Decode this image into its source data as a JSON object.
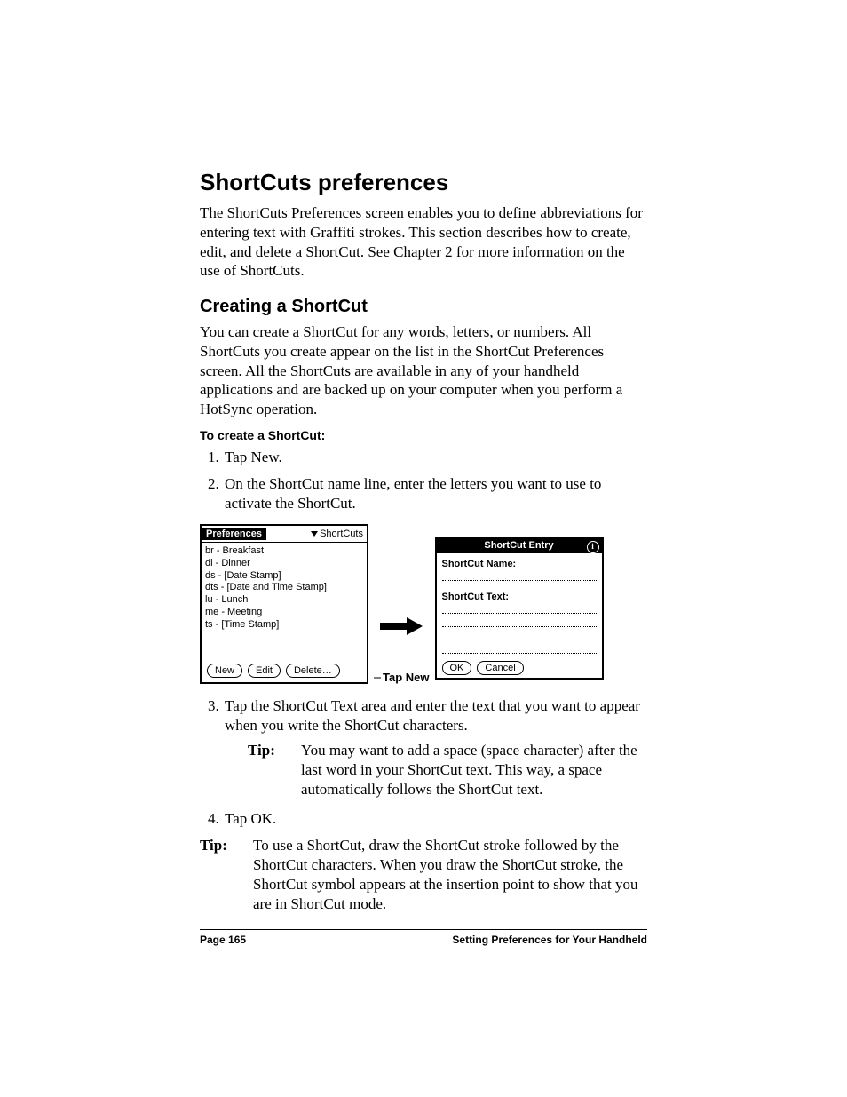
{
  "heading": "ShortCuts preferences",
  "intro": "The ShortCuts Preferences screen enables you to define abbreviations for entering text with Graffiti strokes. This section describes how to create, edit, and delete a ShortCut. See Chapter 2 for more information on the use of ShortCuts.",
  "sub_heading": "Creating a ShortCut",
  "sub_intro": "You can create a ShortCut for any words, letters, or numbers. All ShortCuts you create appear on the list in the ShortCut Preferences screen. All the ShortCuts are available in any of your handheld applications and are backed up on your computer when you perform a HotSync operation.",
  "procedure_title": "To create a ShortCut:",
  "steps": {
    "s1": "Tap New.",
    "s2": "On the ShortCut name line, enter the letters you want to use to activate the ShortCut.",
    "s3": "Tap the ShortCut Text area and enter the text that you want to appear when you write the ShortCut characters.",
    "tip3_label": "Tip:",
    "tip3_text": "You may want to add a space (space character) after the last word in your ShortCut text. This way, a space automatically follows the ShortCut text.",
    "s4": "Tap OK."
  },
  "final_tip_label": "Tip:",
  "final_tip_text": "To use a ShortCut, draw the ShortCut stroke followed by the ShortCut characters. When you draw the ShortCut stroke, the ShortCut symbol appears at the insertion point to show that you are in ShortCut mode.",
  "figure": {
    "left": {
      "title": "Preferences",
      "dropdown": "ShortCuts",
      "list": [
        "br - Breakfast",
        "di - Dinner",
        "ds - [Date Stamp]",
        "dts - [Date and Time Stamp]",
        "lu - Lunch",
        "me - Meeting",
        "ts - [Time Stamp]"
      ],
      "buttons": {
        "new": "New",
        "edit": "Edit",
        "delete": "Delete…"
      }
    },
    "callout": "Tap New",
    "right": {
      "title": "ShortCut Entry",
      "name_label": "ShortCut Name:",
      "text_label": "ShortCut Text:",
      "ok": "OK",
      "cancel": "Cancel"
    }
  },
  "footer": {
    "page": "Page 165",
    "section": "Setting Preferences for Your Handheld"
  }
}
